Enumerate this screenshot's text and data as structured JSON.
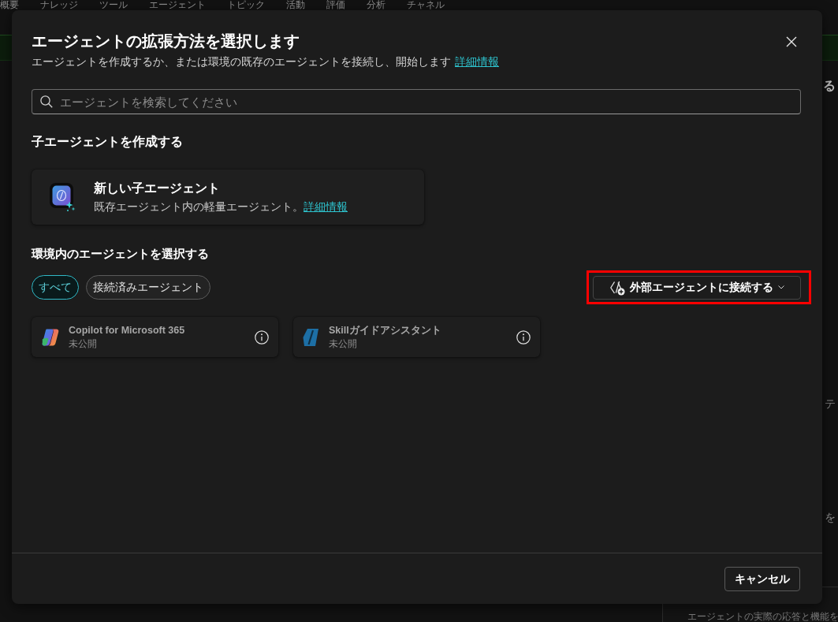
{
  "background": {
    "nav_tabs": [
      "概要",
      "ナレッジ",
      "ツール",
      "エージェント",
      "トピック",
      "活動",
      "評価",
      "分析",
      "チャネル"
    ],
    "side_fragments": [
      "る",
      "テ",
      "を"
    ],
    "footer_text": "エージェントの実際の応答と機能を"
  },
  "dialog": {
    "title": "エージェントの拡張方法を選択します",
    "subtitle": "エージェントを作成するか、または環境の既存のエージェントを接続し、開始します",
    "subtitle_link": "詳細情報",
    "search": {
      "placeholder": "エージェントを検索してください"
    },
    "create_section": {
      "heading": "子エージェントを作成する",
      "card": {
        "title": "新しい子エージェント",
        "description": "既存エージェント内の軽量エージェント。",
        "link": "詳細情報"
      }
    },
    "select_section": {
      "heading": "環境内のエージェントを選択する",
      "filters": [
        {
          "label": "すべて",
          "selected": true
        },
        {
          "label": "接続済みエージェント",
          "selected": false
        }
      ],
      "connect_button": {
        "label": "外部エージェントに接続する",
        "highlighted": true
      },
      "agents": [
        {
          "kind": "copilot",
          "name": "Copilot for Microsoft 365",
          "status": "未公開"
        },
        {
          "kind": "skill",
          "name": "Skillガイドアシスタント",
          "status": "未公開"
        }
      ]
    },
    "buttons": [
      "キャンセル"
    ]
  }
}
